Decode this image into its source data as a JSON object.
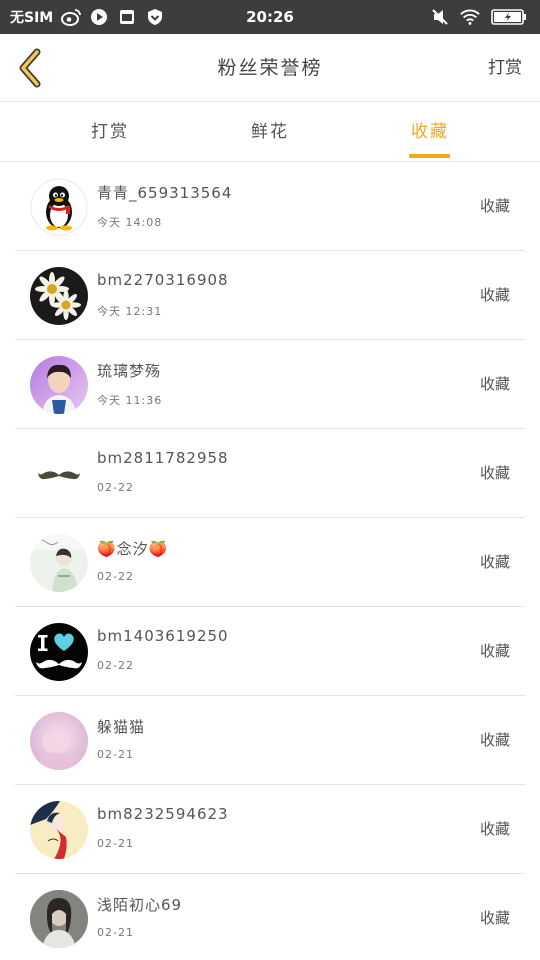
{
  "status_bar": {
    "carrier": "无SIM",
    "time": "20:26"
  },
  "header": {
    "title": "粉丝荣誉榜",
    "action": "打赏"
  },
  "tabs": [
    {
      "label": "打赏"
    },
    {
      "label": "鲜花"
    },
    {
      "label": "收藏"
    }
  ],
  "active_tab": 2,
  "colors": {
    "accent": "#f5a623",
    "status_bar": "#3d3d3d",
    "divider": "#e4e4e4"
  },
  "items": [
    {
      "name": "青青_659313564",
      "time": "今天 14:08",
      "action": "收藏",
      "avatar": "penguin"
    },
    {
      "name": "bm2270316908",
      "time": "今天 12:31",
      "action": "收藏",
      "avatar": "daisy"
    },
    {
      "name": "琉璃梦殇",
      "time": "今天 11:36",
      "action": "收藏",
      "avatar": "boy-photo"
    },
    {
      "name": "bm2811782958",
      "time": "02-22",
      "action": "收藏",
      "avatar": "mustache"
    },
    {
      "name": "🍑念汐🍑",
      "time": "02-22",
      "action": "收藏",
      "avatar": "sketch-boy"
    },
    {
      "name": "bm1403619250",
      "time": "02-22",
      "action": "收藏",
      "avatar": "i-heart-mustache"
    },
    {
      "name": "躲猫猫",
      "time": "02-21",
      "action": "收藏",
      "avatar": "pink-photo"
    },
    {
      "name": "bm8232594623",
      "time": "02-21",
      "action": "收藏",
      "avatar": "girl-illustration"
    },
    {
      "name": "浅陌初心69",
      "time": "02-21",
      "action": "收藏",
      "avatar": "girl-photo"
    }
  ]
}
